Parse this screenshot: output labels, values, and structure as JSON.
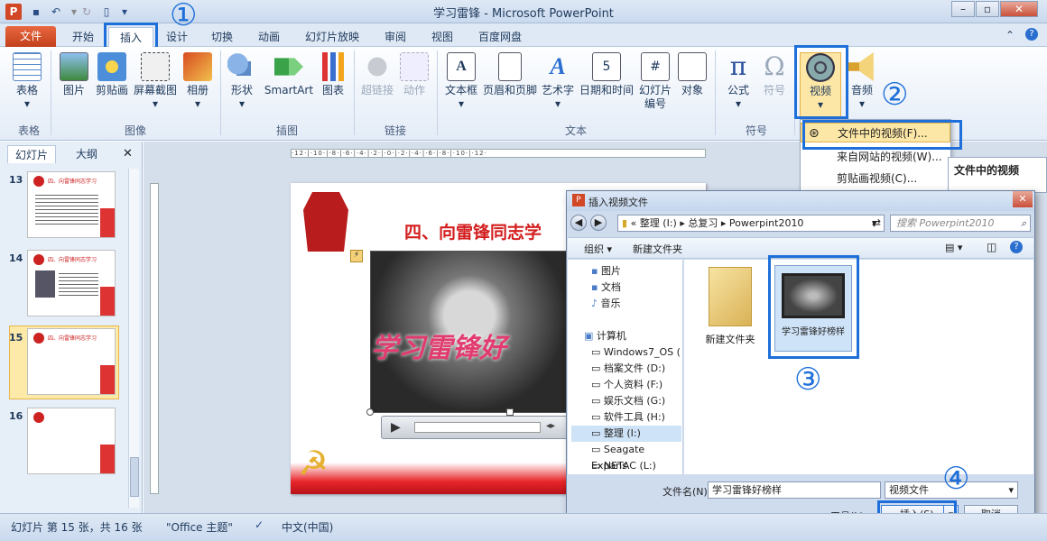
{
  "window": {
    "title": "学习雷锋 - Microsoft PowerPoint",
    "app_letter": "P"
  },
  "tabs": [
    "文件",
    "开始",
    "插入",
    "设计",
    "切换",
    "动画",
    "幻灯片放映",
    "审阅",
    "视图",
    "百度网盘"
  ],
  "ribbon": {
    "buttons": [
      "表格",
      "图片",
      "剪贴画",
      "屏幕截图",
      "相册",
      "形状",
      "SmartArt",
      "图表",
      "超链接",
      "动作",
      "文本框",
      "页眉和页脚",
      "艺术字",
      "日期和时间",
      "幻灯片",
      "编号",
      "对象",
      "公式",
      "符号",
      "视频",
      "音频"
    ],
    "groups": [
      "表格",
      "图像",
      "插图",
      "链接",
      "文本",
      "符号"
    ]
  },
  "panel": {
    "tab_slides": "幻灯片",
    "tab_outline": "大纲",
    "close": "✕"
  },
  "thumbnails": [
    {
      "num": "13",
      "title": "四、向雷锋同志学习",
      "selected": false
    },
    {
      "num": "14",
      "title": "四、向雷锋同志学习",
      "selected": false
    },
    {
      "num": "15",
      "title": "四、向雷锋同志学习",
      "selected": true
    },
    {
      "num": "16",
      "title": "",
      "selected": false
    }
  ],
  "ruler_text": "·12·|·10·|·8·|·6·|·4·|·2·|·0·|·2·|·4·|·6·|·8·|·10·|·12·",
  "slide": {
    "heading": "四、向雷锋同志学",
    "overlay_text": "学习雷锋好"
  },
  "video_menu": {
    "items": [
      "文件中的视频(F)...",
      "来自网站的视频(W)...",
      "剪贴画视频(C)..."
    ],
    "tooltip_title": "文件中的视频"
  },
  "dialog": {
    "title": "插入视频文件",
    "breadcrumb": [
      "«",
      "整理 (I:)",
      "总复习",
      "Powerpint2010"
    ],
    "search_placeholder": "搜索 Powerpint2010",
    "toolbar": {
      "organize": "组织 ▾",
      "new_folder": "新建文件夹"
    },
    "nav_items": [
      "图片",
      "文档",
      "音乐",
      "计算机",
      "Windows7_OS (",
      "档案文件 (D:)",
      "个人资料 (F:)",
      "娱乐文档 (G:)",
      "软件工具 (H:)",
      "整理 (I:)",
      "Seagate Expans",
      "NETAC (L:)"
    ],
    "files": [
      {
        "name": "新建文件夹"
      },
      {
        "name": "学习雷锋好榜样"
      }
    ],
    "filename_label": "文件名(N):",
    "filename_value": "学习雷锋好榜样",
    "filetype_value": "视频文件",
    "tools_label": "工具(L)",
    "insert_label": "插入(S)",
    "cancel_label": "取消"
  },
  "status": {
    "slide_info": "幻灯片 第 15 张，共 16 张",
    "theme": "\"Office 主题\"",
    "language": "中文(中国)"
  },
  "annotations": [
    "①",
    "②",
    "③",
    "④"
  ],
  "colors": {
    "accent": "#1e6fd9",
    "file_tab": "#d24726",
    "slide_red": "#d31f1f"
  }
}
